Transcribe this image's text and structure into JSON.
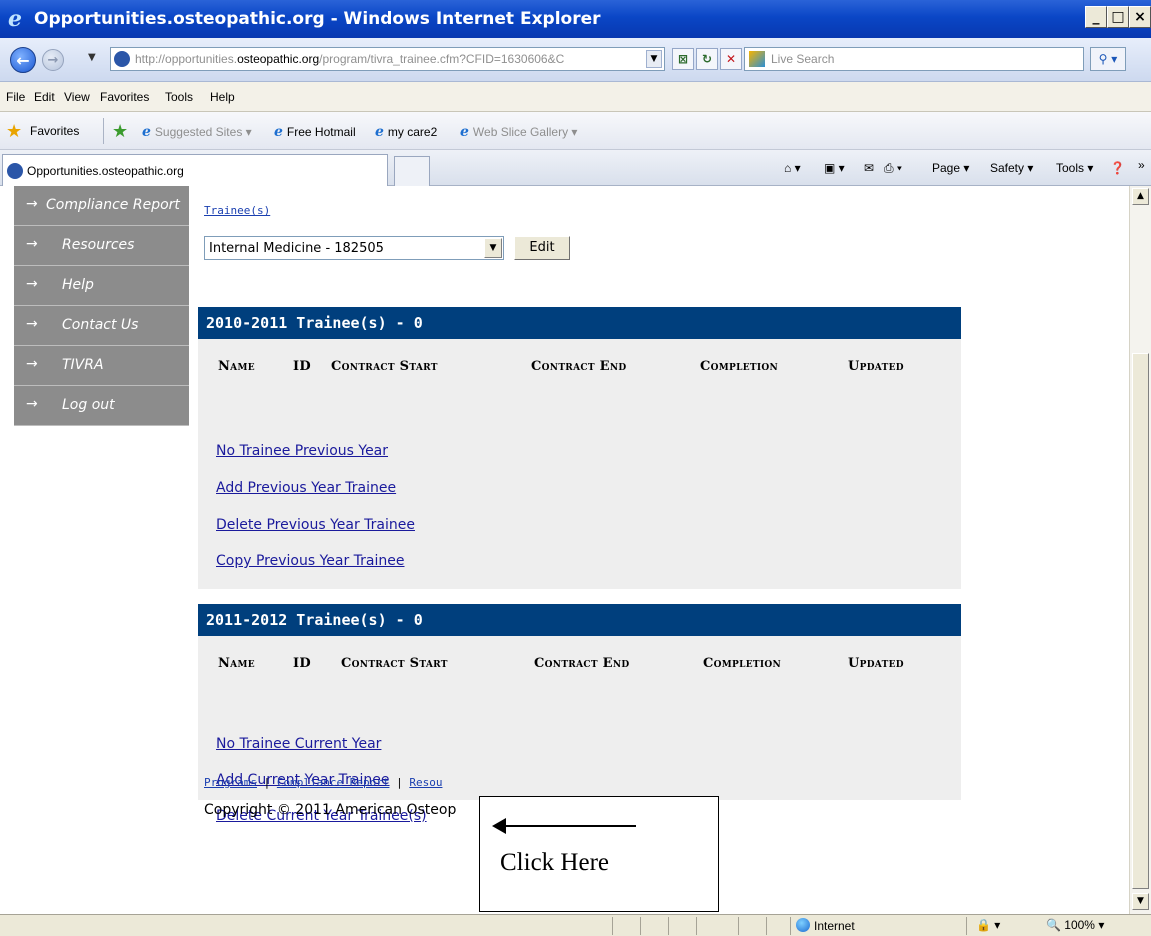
{
  "window": {
    "title": "Opportunities.osteopathic.org - Windows Internet Explorer",
    "buttons": {
      "minimize": "_",
      "maximize": "□",
      "close": "×"
    }
  },
  "address_bar": {
    "url_prefix": "http://opportunities.",
    "url_domain": "osteopathic.org",
    "url_suffix": "/program/tivra_trainee.cfm?CFID=1630606&C",
    "search_placeholder": "Live Search"
  },
  "menu": [
    "File",
    "Edit",
    "View",
    "Favorites",
    "Tools",
    "Help"
  ],
  "favorites_bar": {
    "label": "Favorites",
    "items": [
      "Suggested Sites ▾",
      "Free Hotmail",
      "my care2",
      "Web Slice Gallery ▾"
    ]
  },
  "tab": {
    "title": "Opportunities.osteopathic.org"
  },
  "command_bar": {
    "page": "Page ▾",
    "safety": "Safety ▾",
    "tools": "Tools ▾",
    "more": "»"
  },
  "sidebar": {
    "items": [
      {
        "label": "Compliance Report"
      },
      {
        "label": "Resources"
      },
      {
        "label": "Help"
      },
      {
        "label": "Contact Us"
      },
      {
        "label": "TIVRA"
      },
      {
        "label": "Log out"
      }
    ]
  },
  "main": {
    "breadcrumb": "Trainee(s)",
    "program_select": "Internal Medicine - 182505",
    "edit_label": "Edit",
    "columns": [
      "Name",
      "ID",
      "Contract Start",
      "Contract End",
      "Completion",
      "Updated"
    ],
    "previous_year": {
      "heading": "2010-2011 Trainee(s) - 0",
      "links": [
        "No Trainee Previous Year",
        "Add Previous Year Trainee",
        "Delete Previous Year Trainee",
        "Copy Previous Year Trainee"
      ]
    },
    "current_year": {
      "heading": "2011-2012 Trainee(s) - 0",
      "links": [
        "No Trainee Current Year",
        "Add Current Year Trainee",
        "Delete Current Year Trainee(s)"
      ]
    },
    "footer_links": [
      "Programs",
      "Compliance Report",
      "Resou"
    ],
    "copyright": "Copyright © 2011 American Osteop"
  },
  "callout": {
    "text": "Click Here"
  },
  "status_bar": {
    "zone": "Internet",
    "zoom": "100%"
  }
}
